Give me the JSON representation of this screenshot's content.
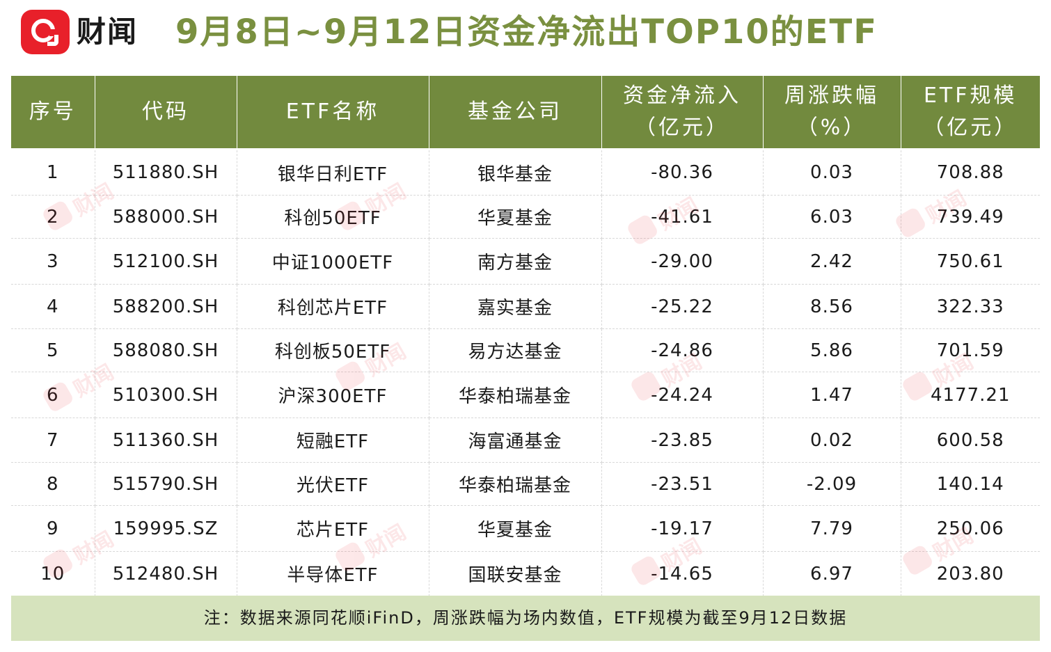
{
  "header": {
    "logo_text": "财闻",
    "title": "9月8日~9月12日资金净流出TOP10的ETF"
  },
  "table": {
    "columns": [
      {
        "line1": "序号",
        "line2": ""
      },
      {
        "line1": "代码",
        "line2": ""
      },
      {
        "line1": "ETF名称",
        "line2": ""
      },
      {
        "line1": "基金公司",
        "line2": ""
      },
      {
        "line1": "资金净流入",
        "line2": "（亿元）"
      },
      {
        "line1": "周涨跌幅",
        "line2": "（%）"
      },
      {
        "line1": "ETF规模",
        "line2": "（亿元）"
      }
    ],
    "rows": [
      [
        "1",
        "511880.SH",
        "银华日利ETF",
        "银华基金",
        "-80.36",
        "0.03",
        "708.88"
      ],
      [
        "2",
        "588000.SH",
        "科创50ETF",
        "华夏基金",
        "-41.61",
        "6.03",
        "739.49"
      ],
      [
        "3",
        "512100.SH",
        "中证1000ETF",
        "南方基金",
        "-29.00",
        "2.42",
        "750.61"
      ],
      [
        "4",
        "588200.SH",
        "科创芯片ETF",
        "嘉实基金",
        "-25.22",
        "8.56",
        "322.33"
      ],
      [
        "5",
        "588080.SH",
        "科创板50ETF",
        "易方达基金",
        "-24.86",
        "5.86",
        "701.59"
      ],
      [
        "6",
        "510300.SH",
        "沪深300ETF",
        "华泰柏瑞基金",
        "-24.24",
        "1.47",
        "4177.21"
      ],
      [
        "7",
        "511360.SH",
        "短融ETF",
        "海富通基金",
        "-23.85",
        "0.02",
        "600.58"
      ],
      [
        "8",
        "515790.SH",
        "光伏ETF",
        "华泰柏瑞基金",
        "-23.51",
        "-2.09",
        "140.14"
      ],
      [
        "9",
        "159995.SZ",
        "芯片ETF",
        "华夏基金",
        "-19.17",
        "7.79",
        "250.06"
      ],
      [
        "10",
        "512480.SH",
        "半导体ETF",
        "国联安基金",
        "-14.65",
        "6.97",
        "203.80"
      ]
    ]
  },
  "note": "注：数据来源同花顺iFinD，周涨跌幅为场内数值，ETF规模为截至9月12日数据",
  "watermark_text": "财闻",
  "colors": {
    "brand_red": "#e8202a",
    "title_green": "#7a9040",
    "header_green": "#728a3e",
    "note_bg": "#d6e3bd"
  }
}
